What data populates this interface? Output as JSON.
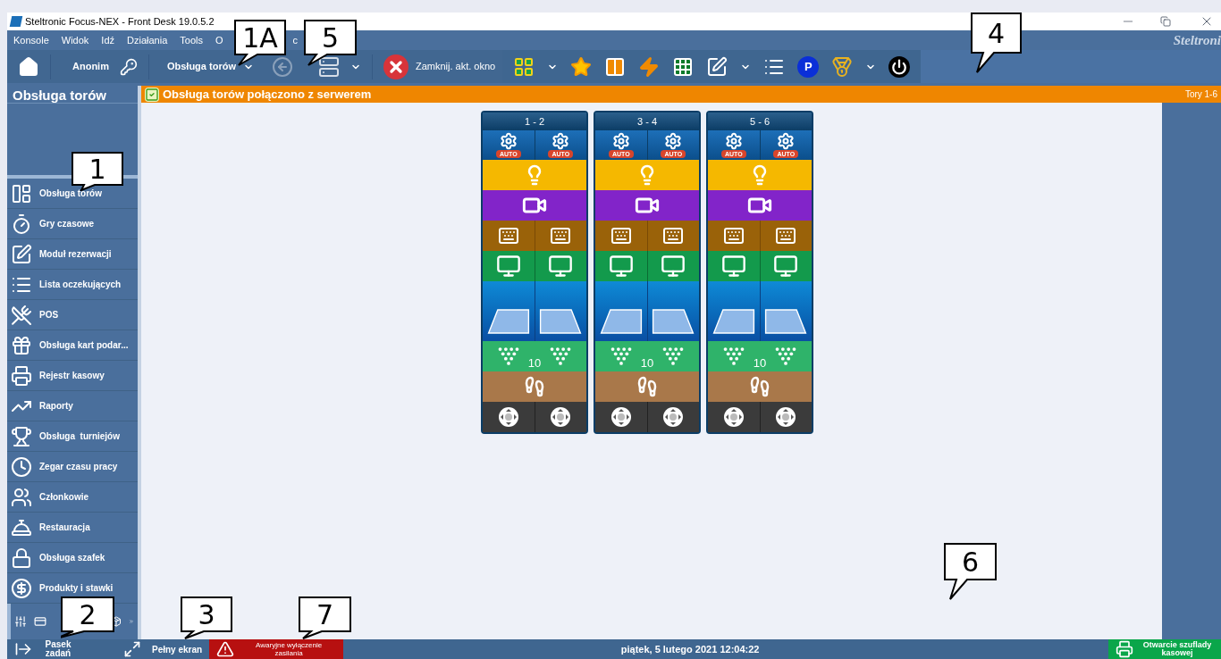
{
  "window": {
    "title": "Steltronic Focus-NEX - Front Desk 19.0.5.2",
    "logo": "Steltroni"
  },
  "menu": [
    {
      "label": "Konsole"
    },
    {
      "label": "Widok"
    },
    {
      "label": "Idź"
    },
    {
      "label": "Działania"
    },
    {
      "label": "Tools"
    },
    {
      "label": "O"
    },
    {
      "label": "c"
    }
  ],
  "toolbar": {
    "user": "Anonim",
    "module_dropdown": "Obsługa torów",
    "back_disabled": true,
    "parking": "P",
    "close_button": "Zamknij. akt. okno"
  },
  "status_banner": {
    "text": "Obsługa torów połączono z serwerem",
    "range": "Tory 1-6"
  },
  "sidebar": {
    "title": "Obsługa torów",
    "items": [
      {
        "label": "Obsługa torów"
      },
      {
        "label": "Gry czasowe"
      },
      {
        "label": "Moduł rezerwacji"
      },
      {
        "label": "Lista oczekujących"
      },
      {
        "label": "POS"
      },
      {
        "label": "Obsługa kart podar..."
      },
      {
        "label": "Rejestr kasowy"
      },
      {
        "label": "Raporty"
      },
      {
        "label": "Obsługa  turniejów"
      },
      {
        "label": "Zegar czasu pracy"
      },
      {
        "label": "Członkowie"
      },
      {
        "label": "Restauracja"
      },
      {
        "label": "Obsługa szafek"
      },
      {
        "label": "Produkty i stawki"
      }
    ]
  },
  "lane_pairs": [
    {
      "label": "1 - 2",
      "auto": [
        "AUTO",
        "AUTO"
      ],
      "pins": "10"
    },
    {
      "label": "3 - 4",
      "auto": [
        "AUTO",
        "AUTO"
      ],
      "pins": "10"
    },
    {
      "label": "5 - 6",
      "auto": [
        "AUTO",
        "AUTO"
      ],
      "pins": "10"
    }
  ],
  "callouts": [
    "1A",
    "5",
    "4",
    "1",
    "2",
    "3",
    "7",
    "6"
  ],
  "bottom_bar": {
    "taskbar_button": "Pasek zadań",
    "fullscreen_button": "Pełny ekran",
    "emergency_button": "Awaryjne wyłączenie zasilania",
    "datetime": "piątek, 5 lutego 2021 12:04:22",
    "drawer_button": "Otwarcie szuflady kasowej"
  }
}
